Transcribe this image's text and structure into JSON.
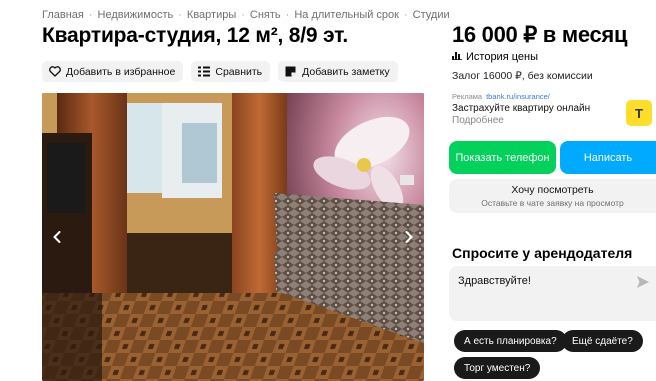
{
  "breadcrumbs": [
    "Главная",
    "Недвижимость",
    "Квартиры",
    "Снять",
    "На длительный срок",
    "Студии"
  ],
  "title": "Квартира-студия, 12 м², 8/9 эт.",
  "actions": {
    "favorite": "Добавить в избранное",
    "compare": "Сравнить",
    "note": "Добавить заметку"
  },
  "gallery": {
    "prev_icon": "chevron-left-icon",
    "next_icon": "chevron-right-icon"
  },
  "price": "16 000 ₽ в месяц",
  "price_history": "История цены",
  "deposit": "Залог 16000 ₽, без комиссии",
  "ad": {
    "label": "Реклама",
    "link": "tbank.ru/insurance/",
    "text": "Застрахуйте квартиру онлайн",
    "more": "Подробнее",
    "logo_letter": "Т"
  },
  "buttons": {
    "phone": "Показать телефон",
    "write": "Написать",
    "view_title": "Хочу посмотреть",
    "view_subtitle": "Оставьте в чате заявку на просмотр"
  },
  "ask": {
    "title": "Спросите у арендодателя",
    "message": "Здравствуйте!",
    "chips": [
      "А есть планировка?",
      "Ещё сдаёте?",
      "Торг уместен?"
    ]
  },
  "colors": {
    "green": "#02d15c",
    "blue": "#00aaff",
    "gray_bg": "#f2f2f2",
    "ad_logo": "#ffdd2d"
  }
}
